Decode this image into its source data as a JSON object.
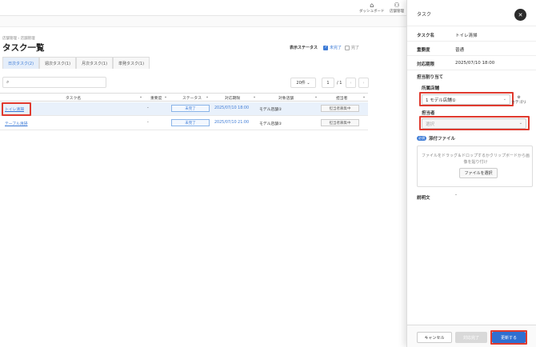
{
  "header": {
    "nav": [
      {
        "icon": "home-icon",
        "label": "ダッシュボード"
      },
      {
        "icon": "users-icon",
        "label": "店舗管理"
      }
    ]
  },
  "page": {
    "breadcrumb": "店舗管理 › 店舗管理",
    "title": "タスク一覧",
    "status_filter": {
      "label": "表示ステータス",
      "options": [
        {
          "label": "未完了",
          "checked": true
        },
        {
          "label": "完了",
          "checked": false
        }
      ]
    },
    "tabs": [
      "日次タスク(2)",
      "週次タスク(1)",
      "月次タスク(1)",
      "単発タスク(1)"
    ],
    "active_tab": 0,
    "pager": {
      "per_page": "20件",
      "page": "1",
      "total": "/ 1"
    },
    "table": {
      "columns": [
        "タスク名",
        "重要度",
        "ステータス",
        "対応期限",
        "対象店舗",
        "担当者"
      ],
      "rows": [
        {
          "name": "トイレ清掃",
          "importance": "-",
          "status": "未完了",
          "deadline": "2025/07/10 18:00",
          "store": "モデル店舗①",
          "assignee": "担当者募集中"
        },
        {
          "name": "テーブル清掃",
          "importance": "-",
          "status": "未完了",
          "deadline": "2025/07/10 21:00",
          "store": "モデル店舗①",
          "assignee": "担当者募集中"
        }
      ]
    }
  },
  "drawer": {
    "title": "タスク",
    "fields": [
      {
        "label": "タスク名",
        "value": "トイレ清掃"
      },
      {
        "label": "重要度",
        "value": "普通"
      },
      {
        "label": "対応期限",
        "value": "2025/07/10 18:00"
      }
    ],
    "assignment": {
      "label": "担当割り当て",
      "store_label": "所属店舗",
      "store_value": "1 モデル店舗①",
      "category_link": "カテゴリ",
      "person_label": "担当者",
      "person_placeholder": "選択"
    },
    "attachment": {
      "required_tag": "必須",
      "label": "添付ファイル",
      "drop_text": "ファイルをドラッグ＆ドロップするかクリップボードから画像を貼り付け",
      "select_button": "ファイルを選択"
    },
    "description": {
      "label": "説明文",
      "value": "-"
    },
    "footer": {
      "cancel": "キャンセル",
      "complete": "対応完了",
      "update": "更新する"
    }
  }
}
